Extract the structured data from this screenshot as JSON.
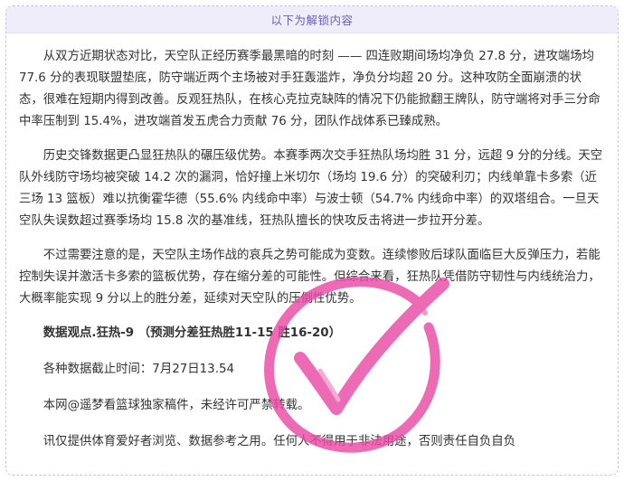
{
  "unlock_label": "以下为解锁内容",
  "paragraphs": {
    "p1": "从双方近期状态对比，天空队正经历赛季最黑暗的时刻 —— 四连败期间场均净负 27.8 分，进攻端场均 77.6 分的表现联盟垫底，防守端近两个主场被对手狂轰滥炸，净负分均超 20 分。这种攻防全面崩溃的状态，很难在短期内得到改善。反观狂热队，在核心克拉克缺阵的情况下仍能掀翻王牌队，防守端将对手三分命中率压制到 15.4%，进攻端首发五虎合力贡献 76 分，团队作战体系已臻成熟。",
    "p2": "历史交锋数据更凸显狂热队的碾压级优势。本赛季两次交手狂热队场均胜 31 分，远超 9 分的分线。天空队外线防守场均被突破 14.2 次的漏洞，恰好撞上米切尔（场均 19.6 分）的突破利刃；内线单靠卡多索（近三场 13 篮板）难以抗衡霍华德（55.6% 内线命中率）与波士顿（54.7% 内线命中率）的双塔组合。一旦天空队失误数超过赛季场均 15.8 次的基准线，狂热队擅长的快攻反击将进一步拉开分差。",
    "p3": "不过需要注意的是，天空队主场作战的哀兵之势可能成为变数。连续惨败后球队面临巨大反弹压力，若能控制失误并激活卡多索的篮板优势，存在缩分差的可能性。但综合来看，狂热队凭借防守韧性与内线统治力，大概率能实现 9 分以上的胜分差，延续对天空队的压倒性优势。",
    "viewpoint": "数据观点.狂热-9 （预测分差狂热胜11-15 胜16-20）",
    "deadline": "各种数据截止时间：7月27日13.54",
    "copyright": "本网@遥梦看篮球独家稿件，未经许可严禁转载。",
    "disclaimer": "讯仅提供体育爱好者浏览、数据参考之用。任何人不得用于非法用途，否则责任自负自负"
  },
  "stamp": {
    "icon": "check-stamp-icon",
    "color": "#ea4aa6"
  }
}
